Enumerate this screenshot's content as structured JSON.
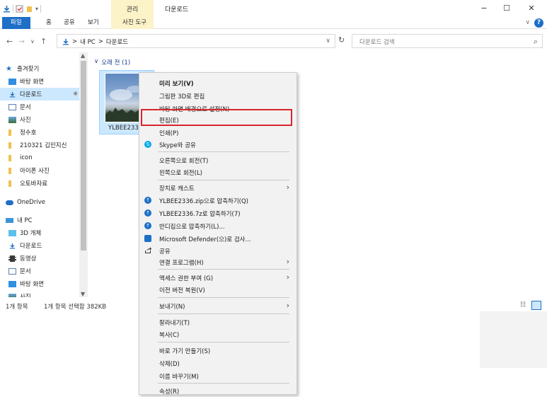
{
  "titlebar": {
    "context_group": "관리",
    "window_title": "다운로드",
    "minimize": "−",
    "maximize": "☐",
    "close": "✕"
  },
  "tabs": {
    "file": "파일",
    "home": "홈",
    "share": "공유",
    "view": "보기",
    "picture_tools": "사진 도구",
    "help": "?",
    "expand": "∨"
  },
  "address": {
    "back": "←",
    "forward": "→",
    "recent": "∨",
    "up": "↑",
    "path": [
      "내 PC",
      "다운로드"
    ],
    "separator": ">",
    "dropdown": "∨",
    "refresh": "↻"
  },
  "search": {
    "placeholder": "다운로드 검색",
    "icon": "⌕"
  },
  "navpane": {
    "items": [
      {
        "label": "즐겨찾기",
        "icon": "star-icon",
        "pinned": false
      },
      {
        "label": "바탕 화면",
        "icon": "desktop-icon",
        "pinned": true
      },
      {
        "label": "다운로드",
        "icon": "download-icon",
        "pinned": true,
        "selected": true
      },
      {
        "label": "문서",
        "icon": "document-icon",
        "pinned": true
      },
      {
        "label": "사진",
        "icon": "picture-icon",
        "pinned": true
      },
      {
        "label": "정수호",
        "icon": "folder-icon",
        "pinned": true
      },
      {
        "label": "210321 김민지신",
        "icon": "folder-icon",
        "pinned": false
      },
      {
        "label": "icon",
        "icon": "folder-icon",
        "pinned": false
      },
      {
        "label": "아이폰 사진",
        "icon": "folder-icon",
        "pinned": false
      },
      {
        "label": "오토바자료",
        "icon": "folder-icon",
        "pinned": false
      },
      {
        "label": "OneDrive",
        "icon": "cloud-icon",
        "pinned": false
      },
      {
        "label": "내 PC",
        "icon": "pc-icon",
        "pinned": false
      },
      {
        "label": "3D 개체",
        "icon": "cube-icon",
        "pinned": false
      },
      {
        "label": "다운로드",
        "icon": "download-icon",
        "pinned": false
      },
      {
        "label": "동영상",
        "icon": "video-icon",
        "pinned": false
      },
      {
        "label": "문서",
        "icon": "document-icon",
        "pinned": false
      },
      {
        "label": "바탕 화면",
        "icon": "desktop-icon",
        "pinned": false
      },
      {
        "label": "사진",
        "icon": "picture-icon",
        "pinned": false
      }
    ],
    "pin_glyph": "✱"
  },
  "content": {
    "group_header": "오래 전 (1)",
    "group_chevron": "∨",
    "file_name": "YLBEE2336"
  },
  "status": {
    "count": "1개 항목",
    "selection": "1개 항목 선택함 382KB"
  },
  "context_menu": {
    "items": [
      {
        "label": "미리 보기(V)",
        "bold": true
      },
      {
        "label": "그림판 3D로 편집"
      },
      {
        "label": "바탕 화면 배경으로 설정(N)"
      },
      {
        "label": "편집(E)",
        "highlighted": true
      },
      {
        "label": "인쇄(P)"
      },
      {
        "label": "Skype와 공유",
        "icon": "skype-icon"
      },
      {
        "label": "오른쪽으로 회전(T)"
      },
      {
        "label": "왼쪽으로 회전(L)"
      },
      {
        "label": "장치로 캐스트",
        "submenu": true
      },
      {
        "label": "YLBEE2336.zip으로 압축하기(Q)",
        "icon": "bandizip-icon"
      },
      {
        "label": "YLBEE2336.7z로 압축하기(7)",
        "icon": "bandizip-icon"
      },
      {
        "label": "반디집으로 압축하기(L)...",
        "icon": "bandizip-icon"
      },
      {
        "label": "Microsoft Defender(으)로 검사...",
        "icon": "defender-icon"
      },
      {
        "label": "공유",
        "icon": "share-icon"
      },
      {
        "label": "연결 프로그램(H)",
        "submenu": true
      },
      {
        "label": "액세스 권한 부여 (G)",
        "submenu": true
      },
      {
        "label": "이전 버전 복원(V)"
      },
      {
        "label": "보내기(N)",
        "submenu": true
      },
      {
        "label": "잘라내기(T)"
      },
      {
        "label": "복사(C)"
      },
      {
        "label": "바로 가기 만들기(S)"
      },
      {
        "label": "삭제(D)"
      },
      {
        "label": "이름 바꾸기(M)"
      },
      {
        "label": "속성(R)"
      }
    ],
    "submenu_arrow": "›"
  },
  "colors": {
    "accent": "#1e6fc6",
    "selection": "#cce8ff",
    "context_tab": "#fcf3c9",
    "highlight_border": "#d9242d"
  }
}
